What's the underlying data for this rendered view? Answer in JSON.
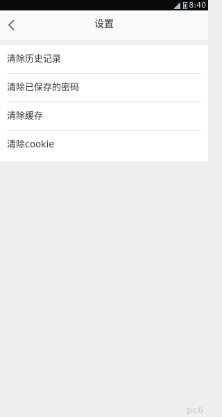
{
  "status_bar": {
    "time": "8:40",
    "icons": [
      "signal-icon",
      "battery-icon"
    ]
  },
  "header": {
    "title": "设置",
    "back_icon": "chevron-left-icon"
  },
  "settings": {
    "items": [
      {
        "label": "清除历史记录"
      },
      {
        "label": "清除已保存的密码"
      },
      {
        "label": "清除缓存"
      },
      {
        "label": "清除cookie"
      }
    ]
  },
  "watermark": "pc6"
}
